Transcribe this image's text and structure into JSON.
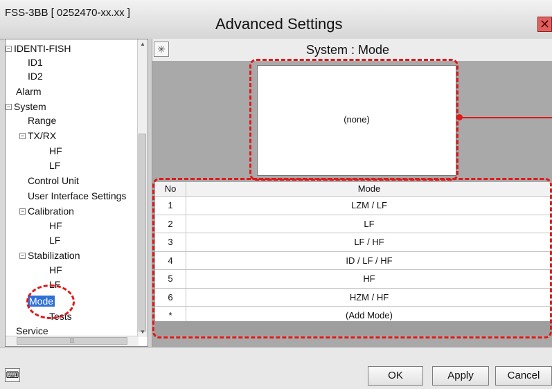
{
  "window": {
    "app_title": "FSS-3BB [ 0252470-xx.xx ]",
    "dialog_title": "Advanced Settings",
    "close_glyph": "✕"
  },
  "tree": {
    "items": [
      {
        "label": "IDENTI-FISH",
        "expander": "−"
      },
      {
        "label": "ID1"
      },
      {
        "label": "ID2"
      },
      {
        "label": "Alarm"
      },
      {
        "label": "System",
        "expander": "−"
      },
      {
        "label": "Range"
      },
      {
        "label": "TX/RX",
        "expander": "−"
      },
      {
        "label": "HF"
      },
      {
        "label": "LF"
      },
      {
        "label": "Control Unit"
      },
      {
        "label": "User Interface Settings"
      },
      {
        "label": "Calibration",
        "expander": "−"
      },
      {
        "label": "HF"
      },
      {
        "label": "LF"
      },
      {
        "label": "Stabilization",
        "expander": "−"
      },
      {
        "label": "HF"
      },
      {
        "label": "LF"
      },
      {
        "label": "Mode",
        "selected": true
      },
      {
        "label": "Tests"
      },
      {
        "label": "Service"
      }
    ]
  },
  "panel": {
    "title": "System : Mode",
    "preview_text": "(none)"
  },
  "table": {
    "headers": {
      "no": "No",
      "mode": "Mode"
    },
    "rows": [
      {
        "no": "1",
        "mode": "LZM / LF"
      },
      {
        "no": "2",
        "mode": "LF"
      },
      {
        "no": "3",
        "mode": "LF / HF"
      },
      {
        "no": "4",
        "mode": "ID / LF / HF"
      },
      {
        "no": "5",
        "mode": "HF"
      },
      {
        "no": "6",
        "mode": "HZM / HF"
      },
      {
        "no": "*",
        "mode": "(Add Mode)"
      }
    ]
  },
  "buttons": {
    "ok": "OK",
    "apply": "Apply",
    "cancel": "Cancel"
  },
  "icons": {
    "keyboard": "keyboard-icon",
    "panel_head": "sparkle-icon"
  },
  "colors": {
    "highlight_dash": "#e01919",
    "selection": "#2e6fd8"
  }
}
